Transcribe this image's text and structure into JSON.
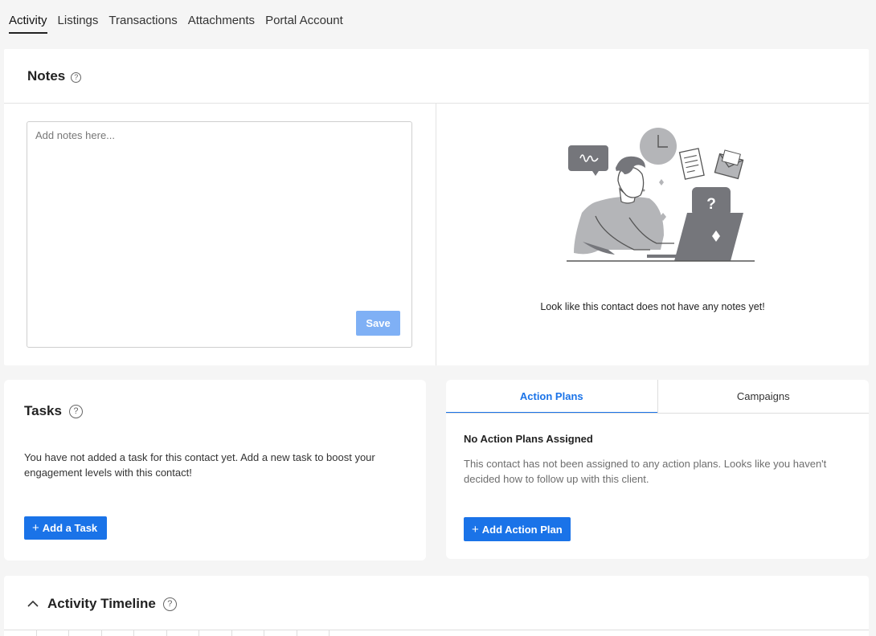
{
  "tabs": [
    {
      "label": "Activity",
      "active": true
    },
    {
      "label": "Listings"
    },
    {
      "label": "Transactions"
    },
    {
      "label": "Attachments"
    },
    {
      "label": "Portal Account"
    }
  ],
  "notes": {
    "title": "Notes",
    "help_glyph": "?",
    "placeholder": "Add notes here...",
    "save_label": "Save",
    "empty_message": "Look like this contact does not have any notes yet!",
    "illustration_glyph": "?"
  },
  "tasks": {
    "title": "Tasks",
    "help_glyph": "?",
    "empty_message": "You have not added a task for this contact yet. Add a new task to boost your engagement levels with this contact!",
    "add_icon": "+",
    "add_label": "Add a Task"
  },
  "plans": {
    "tabs": [
      {
        "label": "Action Plans",
        "active": true
      },
      {
        "label": "Campaigns"
      }
    ],
    "title": "No Action Plans Assigned",
    "message": "This contact has not been assigned to any action plans. Looks like you haven't decided how to follow up with this client.",
    "add_icon": "+",
    "add_label": "Add Action Plan"
  },
  "timeline": {
    "title": "Activity Timeline",
    "help_glyph": "?"
  },
  "colors": {
    "primary": "#1a73e8",
    "save_disabled": "#7fb0f5",
    "illustration": "#75767b"
  }
}
